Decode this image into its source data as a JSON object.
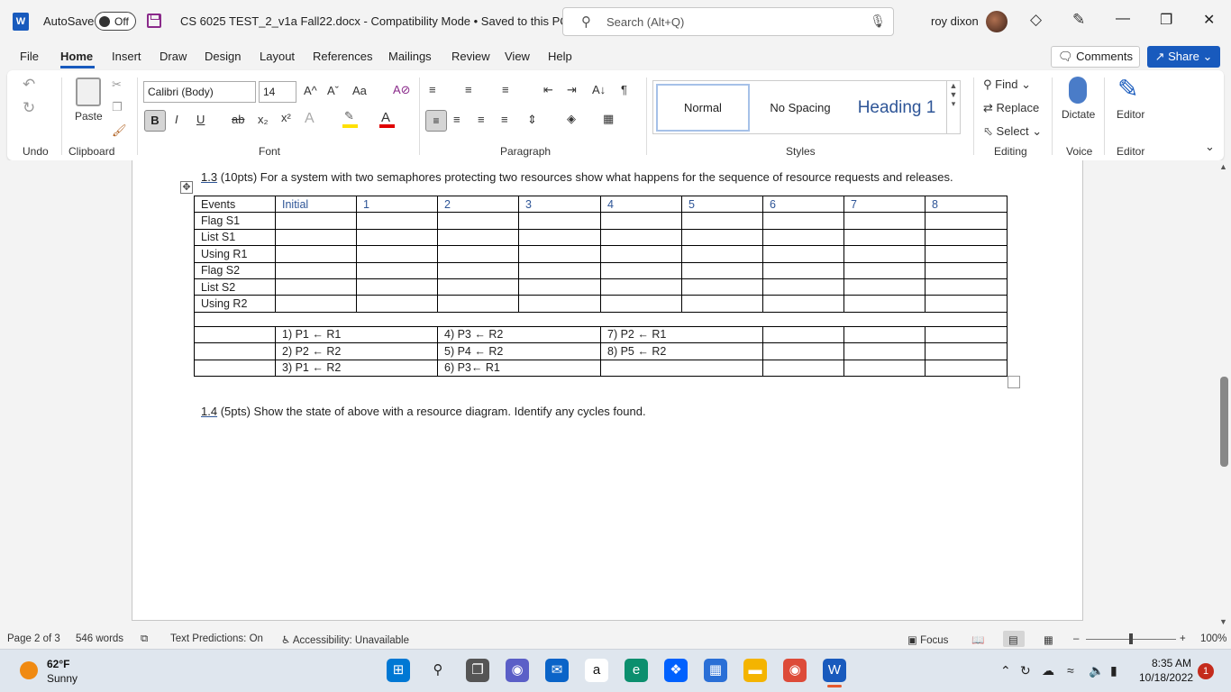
{
  "titlebar": {
    "app_icon": "word-icon",
    "autosave_label": "AutoSave",
    "autosave_state": "Off",
    "doc_title": "CS 6025 TEST_2_v1a Fall22.docx  -  Compatibility Mode • Saved to this PC",
    "search_placeholder": "Search (Alt+Q)",
    "user_name": "roy dixon"
  },
  "menu": {
    "tabs": [
      "File",
      "Home",
      "Insert",
      "Draw",
      "Design",
      "Layout",
      "References",
      "Mailings",
      "Review",
      "View",
      "Help"
    ],
    "active": "Home",
    "comments_label": "Comments",
    "share_label": "Share"
  },
  "ribbon": {
    "groups": {
      "undo": "Undo",
      "clipboard": "Clipboard",
      "font": "Font",
      "paragraph": "Paragraph",
      "styles": "Styles",
      "editing": "Editing",
      "voice": "Voice",
      "editor": "Editor"
    },
    "paste_label": "Paste",
    "font_name": "Calibri (Body)",
    "font_size": "14",
    "styles": [
      "Normal",
      "No Spacing",
      "Heading 1"
    ],
    "find_label": "Find",
    "replace_label": "Replace",
    "select_label": "Select",
    "dictate_label": "Dictate",
    "editor_label": "Editor"
  },
  "document": {
    "q13_num": "1.3",
    "q13_text": " (10pts) For a system with two semaphores protecting two resources show what happens for the sequence of resource requests and releases.",
    "q14_num": "1.4",
    "q14_text": " (5pts) Show the state of above with a resource diagram.   Identify any cycles found.",
    "table": {
      "header": [
        "Events",
        "Initial",
        "1",
        "2",
        "3",
        "4",
        "5",
        "6",
        "7",
        "8"
      ],
      "rows": [
        "Flag S1",
        "List S1",
        "Using R1",
        "Flag S2",
        "List S2",
        "Using R2"
      ],
      "sequence": [
        [
          "1)  P1 ← R1",
          "4)  P3 ← R2",
          "7)  P2 ← R1"
        ],
        [
          "2)  P2 ← R2",
          "5)  P4 ← R2",
          "8)  P5 ← R2"
        ],
        [
          "3)  P1 ← R2",
          "6)  P3← R1",
          ""
        ]
      ]
    }
  },
  "statusbar": {
    "page": "Page 2 of 3",
    "words": "546 words",
    "text_predictions": "Text Predictions: On",
    "accessibility": "Accessibility: Unavailable",
    "focus": "Focus",
    "zoom": "100%"
  },
  "taskbar": {
    "temp": "62°F",
    "condition": "Sunny",
    "time": "8:35 AM",
    "date": "10/18/2022",
    "notifications": "1"
  }
}
